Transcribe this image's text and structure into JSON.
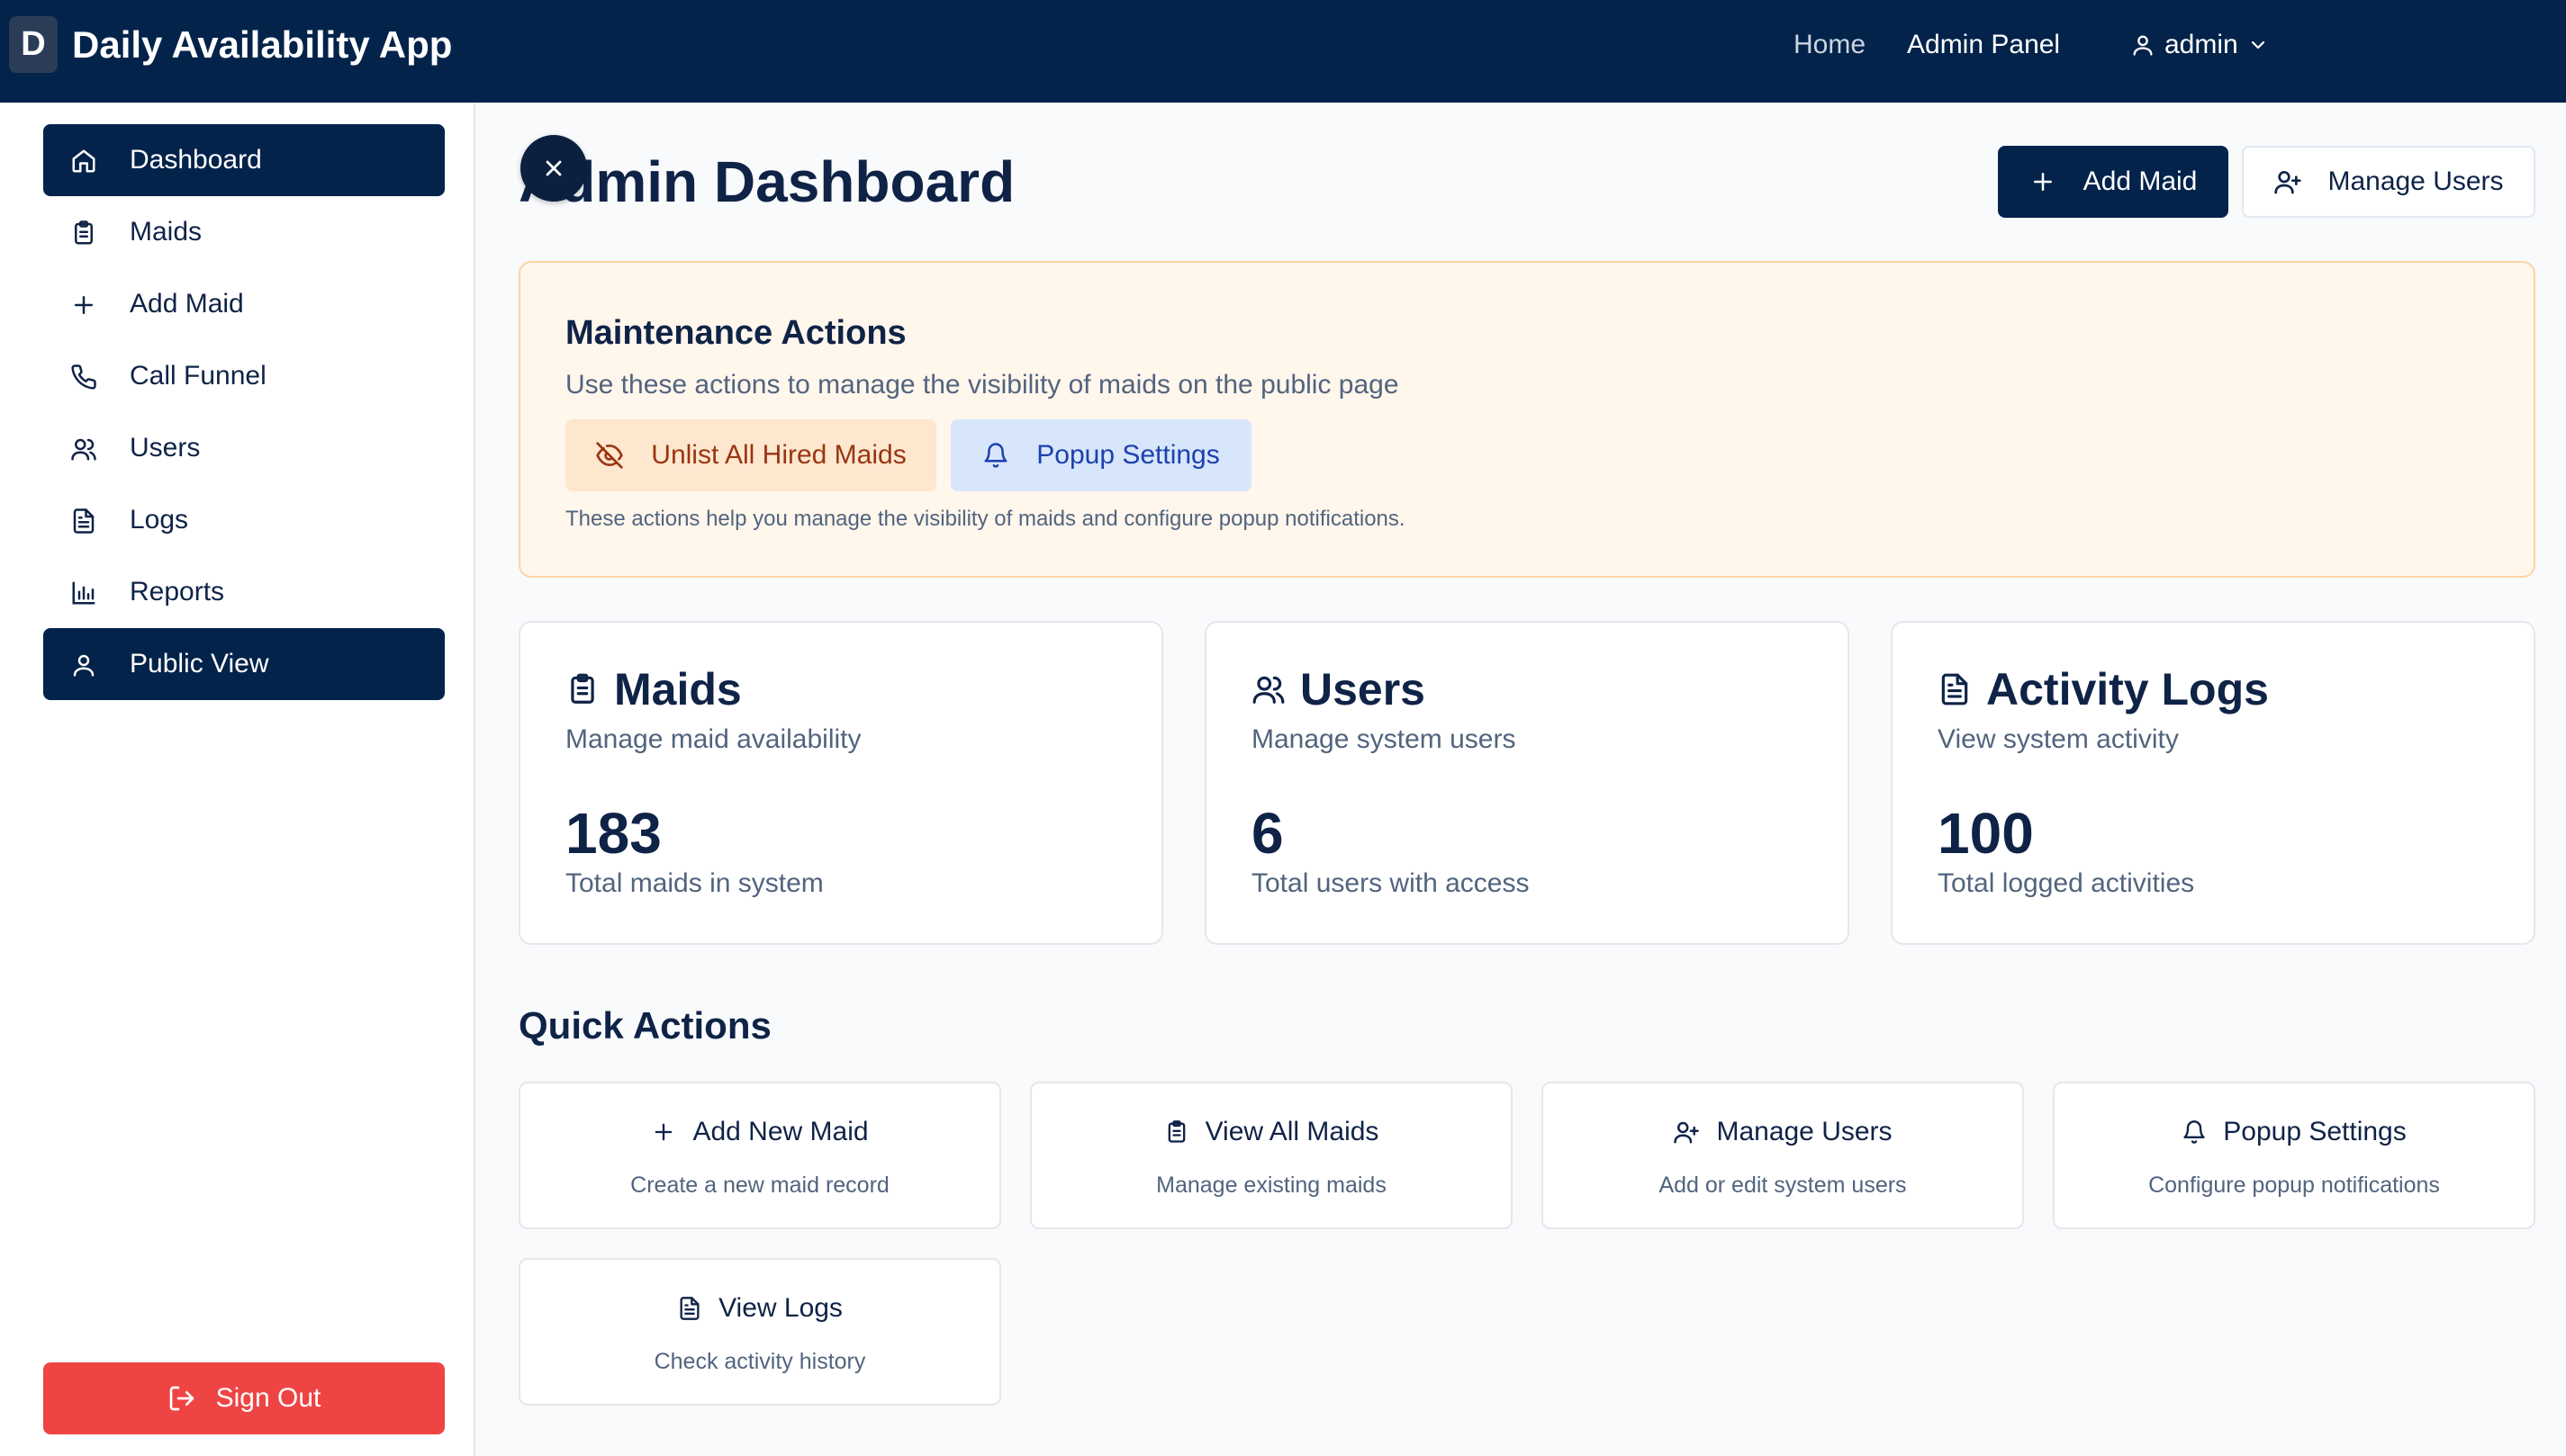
{
  "app": {
    "logo_letter": "D",
    "title": "Daily Availability App"
  },
  "topnav": {
    "home": "Home",
    "admin_panel": "Admin Panel",
    "user": "admin"
  },
  "sidebar": {
    "items": [
      {
        "label": "Dashboard",
        "icon": "home-icon",
        "active": true
      },
      {
        "label": "Maids",
        "icon": "clipboard-icon",
        "active": false
      },
      {
        "label": "Add Maid",
        "icon": "plus-icon",
        "active": false
      },
      {
        "label": "Call Funnel",
        "icon": "phone-icon",
        "active": false
      },
      {
        "label": "Users",
        "icon": "users-icon",
        "active": false
      },
      {
        "label": "Logs",
        "icon": "file-text-icon",
        "active": false
      },
      {
        "label": "Reports",
        "icon": "bar-chart-icon",
        "active": false
      },
      {
        "label": "Public View",
        "icon": "user-icon",
        "active": true
      }
    ],
    "sign_out": "Sign Out"
  },
  "header": {
    "title": "Admin Dashboard",
    "add_maid": "Add Maid",
    "manage_users": "Manage Users"
  },
  "maintenance": {
    "title": "Maintenance Actions",
    "subtitle": "Use these actions to manage the visibility of maids on the public page",
    "unlist_button": "Unlist All Hired Maids",
    "popup_button": "Popup Settings",
    "note": "These actions help you manage the visibility of maids and configure popup notifications."
  },
  "stats": [
    {
      "title": "Maids",
      "subtitle": "Manage maid availability",
      "value": "183",
      "description": "Total maids in system",
      "icon": "clipboard-icon"
    },
    {
      "title": "Users",
      "subtitle": "Manage system users",
      "value": "6",
      "description": "Total users with access",
      "icon": "users-icon"
    },
    {
      "title": "Activity Logs",
      "subtitle": "View system activity",
      "value": "100",
      "description": "Total logged activities",
      "icon": "file-text-icon"
    }
  ],
  "quick_actions": {
    "title": "Quick Actions",
    "items": [
      {
        "label": "Add New Maid",
        "description": "Create a new maid record",
        "icon": "plus-icon"
      },
      {
        "label": "View All Maids",
        "description": "Manage existing maids",
        "icon": "clipboard-icon"
      },
      {
        "label": "Manage Users",
        "description": "Add or edit system users",
        "icon": "user-plus-icon"
      },
      {
        "label": "Popup Settings",
        "description": "Configure popup notifications",
        "icon": "bell-icon"
      },
      {
        "label": "View Logs",
        "description": "Check activity history",
        "icon": "file-text-icon"
      }
    ]
  },
  "colors": {
    "navy": "#03234a",
    "danger": "#ef4444",
    "warning_bg": "#fff6ec",
    "info_bg": "#d7e6fb"
  }
}
